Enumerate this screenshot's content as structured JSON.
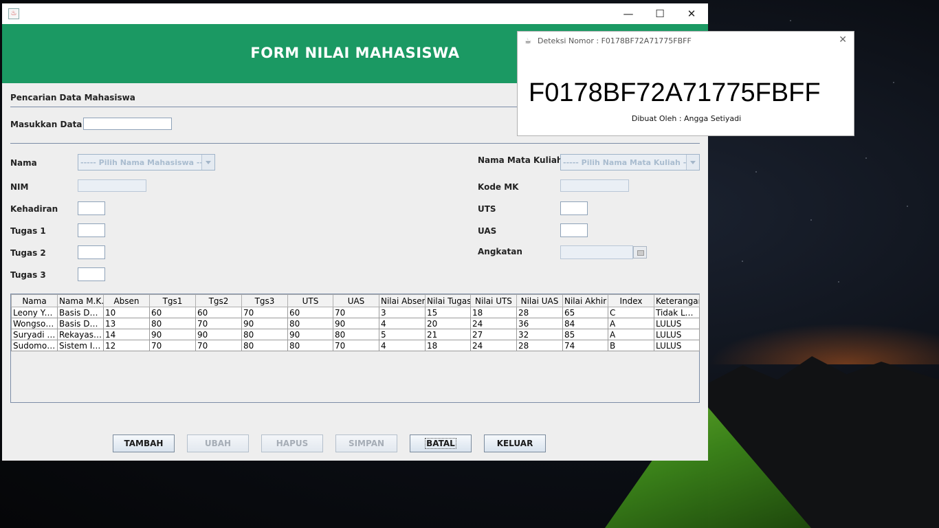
{
  "window": {
    "header_title": "FORM NILAI MAHASISWA",
    "controls": {
      "minimize": "—",
      "maximize": "☐",
      "close": "✕"
    }
  },
  "search": {
    "section_title": "Pencarian Data Mahasiswa",
    "label": "Masukkan Data",
    "value": ""
  },
  "form": {
    "nama_label": "Nama",
    "nama_placeholder": "----- Pilih Nama Mahasiswa -----",
    "nim_label": "NIM",
    "kehadiran_label": "Kehadiran",
    "tugas1_label": "Tugas 1",
    "tugas2_label": "Tugas 2",
    "tugas3_label": "Tugas 3",
    "matkul_label": "Nama Mata Kuliah",
    "matkul_placeholder": "----- Pilih Nama Mata Kuliah -----",
    "kode_label": "Kode MK",
    "uts_label": "UTS",
    "uas_label": "UAS",
    "angkatan_label": "Angkatan"
  },
  "table": {
    "headers": [
      "Nama",
      "Nama M.K.",
      "Absen",
      "Tgs1",
      "Tgs2",
      "Tgs3",
      "UTS",
      "UAS",
      "Nilai Absen",
      "Nilai Tugas",
      "Nilai UTS",
      "Nilai UAS",
      "Nilai Akhir",
      "Index",
      "Keterangan"
    ],
    "rows": [
      [
        "Leony Ye...",
        "Basis Dat...",
        "10",
        "60",
        "60",
        "70",
        "60",
        "70",
        "3",
        "15",
        "18",
        "28",
        "65",
        "C",
        "Tidak Lul..."
      ],
      [
        "Wongsoj...",
        "Basis Dat...",
        "13",
        "80",
        "70",
        "90",
        "80",
        "90",
        "4",
        "20",
        "24",
        "36",
        "84",
        "A",
        "LULUS"
      ],
      [
        "Suryadi P...",
        "Rekayasa...",
        "14",
        "90",
        "90",
        "80",
        "90",
        "80",
        "5",
        "21",
        "27",
        "32",
        "85",
        "A",
        "LULUS"
      ],
      [
        "Sudomo I...",
        "Sistem Inf...",
        "12",
        "70",
        "70",
        "80",
        "80",
        "70",
        "4",
        "18",
        "24",
        "28",
        "74",
        "B",
        "LULUS"
      ]
    ]
  },
  "buttons": {
    "tambah": "TAMBAH",
    "ubah": "UBAH",
    "hapus": "HAPUS",
    "simpan": "SIMPAN",
    "batal": "BATAL",
    "keluar": "KELUAR"
  },
  "dialog": {
    "title": "Deteksi Nomor : F0178BF72A71775FBFF",
    "number": "F0178BF72A71775FBFF",
    "author": "Dibuat Oleh : Angga Setiyadi",
    "close": "✕"
  },
  "colors": {
    "header_green": "#1b9963",
    "window_bg": "#eeeeee"
  },
  "icons": {
    "app": "java-cup-icon",
    "dialog": "java-duke-icon"
  }
}
